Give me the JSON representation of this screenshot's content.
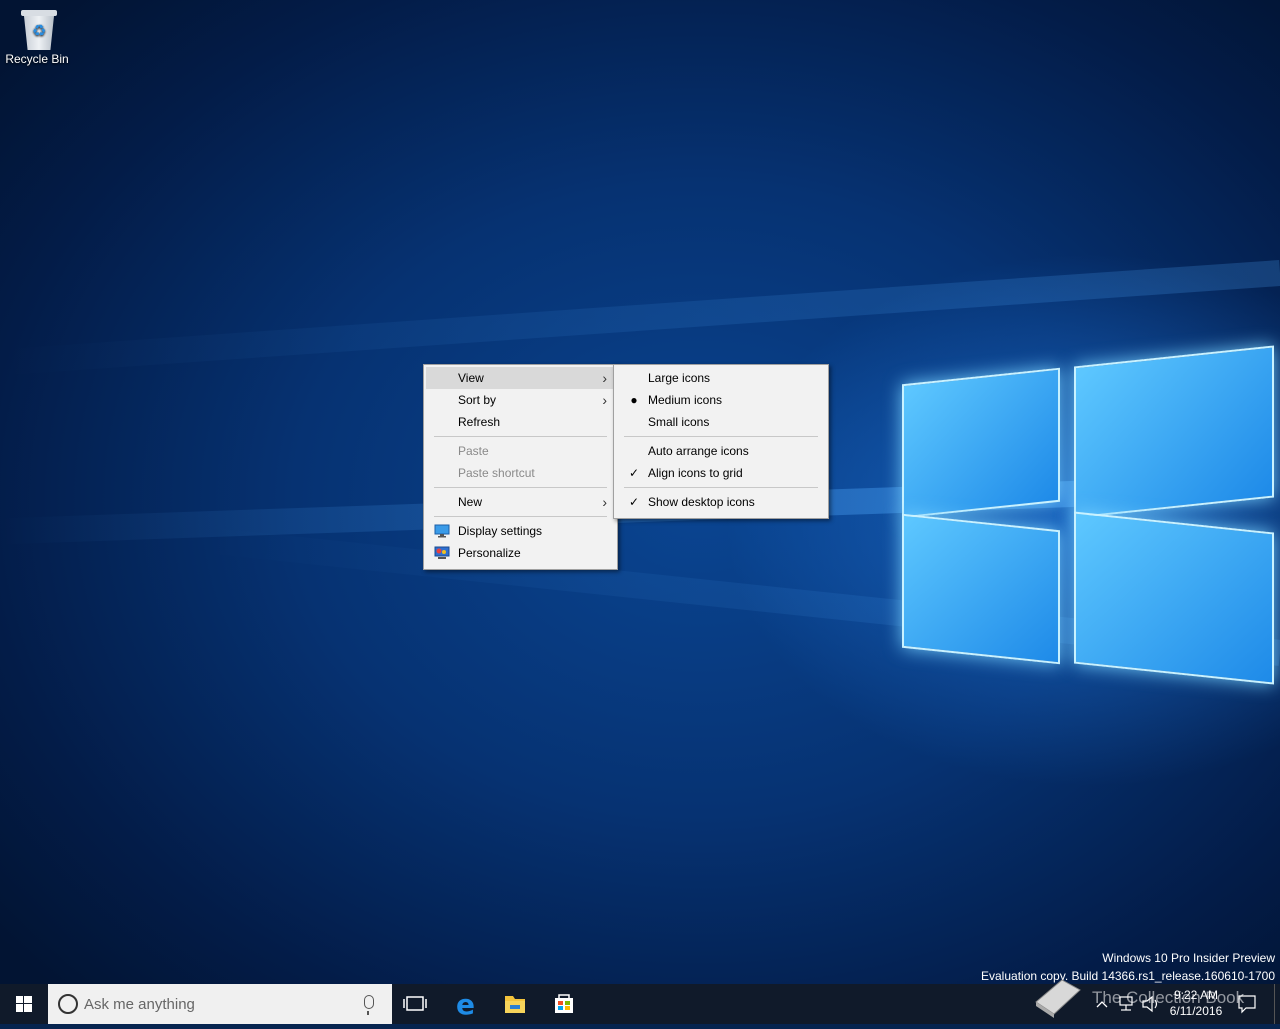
{
  "desktop": {
    "icons": [
      {
        "label": "Recycle Bin",
        "icon": "recycle-bin-icon"
      }
    ]
  },
  "context_menu": {
    "items": [
      {
        "label": "View",
        "submenu": true,
        "highlighted": true
      },
      {
        "label": "Sort by",
        "submenu": true
      },
      {
        "label": "Refresh"
      },
      {
        "label": "Paste",
        "disabled": true
      },
      {
        "label": "Paste shortcut",
        "disabled": true
      },
      {
        "label": "New",
        "submenu": true
      },
      {
        "label": "Display settings",
        "icon": "display-settings-icon"
      },
      {
        "label": "Personalize",
        "icon": "personalize-icon"
      }
    ]
  },
  "view_submenu": {
    "items": [
      {
        "label": "Large icons"
      },
      {
        "label": "Medium icons",
        "selected": true
      },
      {
        "label": "Small icons"
      },
      {
        "label": "Auto arrange icons"
      },
      {
        "label": "Align icons to grid",
        "checked": true
      },
      {
        "label": "Show desktop icons",
        "checked": true
      }
    ]
  },
  "watermark": {
    "line1": "Windows 10 Pro Insider Preview",
    "line2": "Evaluation copy. Build 14366.rs1_release.160610-1700"
  },
  "taskbar": {
    "search_placeholder": "Ask me anything",
    "pinned": [
      "task-view-icon",
      "edge-icon",
      "file-explorer-icon",
      "store-icon"
    ],
    "clock": {
      "time": "9:22 AM",
      "date": "6/11/2016"
    },
    "overlay_text": "The Collection Book"
  },
  "colors": {
    "taskbar": "#101a2a",
    "menu_bg": "#f2f2f2",
    "menu_highlight": "#d9d9d9",
    "accent": "#0078d7"
  }
}
